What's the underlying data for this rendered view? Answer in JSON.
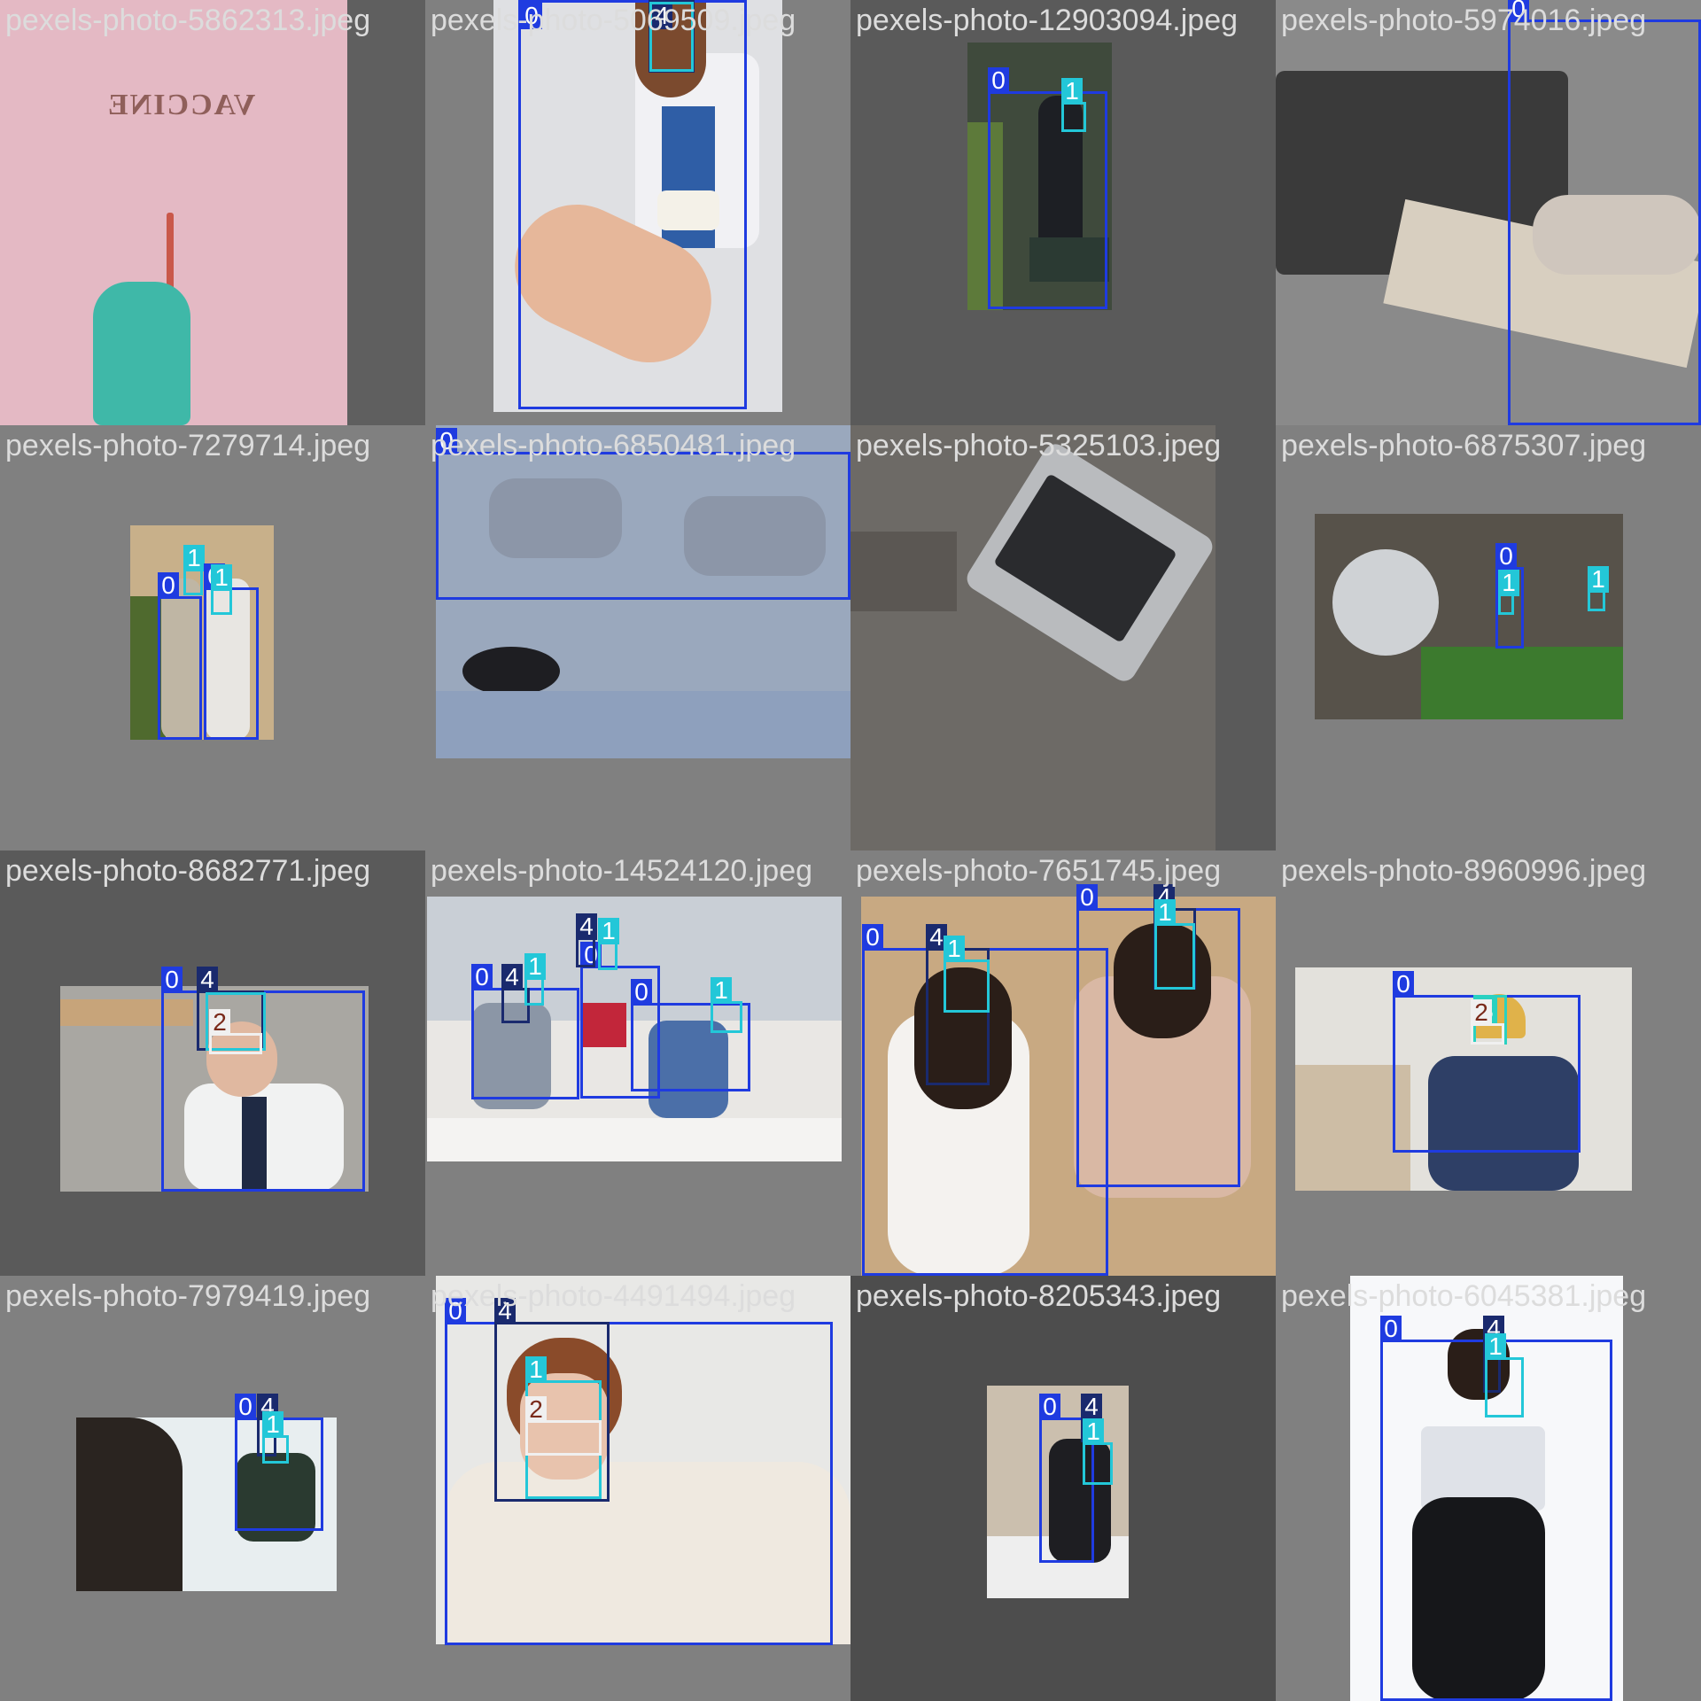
{
  "cells": [
    {
      "file": "pexels-photo-5862313.jpeg",
      "image_text": "VACCINE",
      "labels": []
    },
    {
      "file": "pexels-photo-5069509.jpeg",
      "labels": [
        "0",
        "4"
      ]
    },
    {
      "file": "pexels-photo-12903094.jpeg",
      "labels": [
        "0",
        "1"
      ]
    },
    {
      "file": "pexels-photo-5974016.jpeg",
      "labels": [
        "0"
      ]
    },
    {
      "file": "pexels-photo-7279714.jpeg",
      "labels": [
        "0",
        "1",
        "0",
        "1"
      ]
    },
    {
      "file": "pexels-photo-6850481.jpeg",
      "labels": [
        "0"
      ]
    },
    {
      "file": "pexels-photo-5325103.jpeg",
      "labels": []
    },
    {
      "file": "pexels-photo-6875307.jpeg",
      "labels": [
        "0",
        "1",
        "1"
      ]
    },
    {
      "file": "pexels-photo-8682771.jpeg",
      "labels": [
        "0",
        "4",
        "2"
      ]
    },
    {
      "file": "pexels-photo-14524120.jpeg",
      "labels": [
        "0",
        "4",
        "1",
        "0",
        "4",
        "1",
        "0",
        "1"
      ]
    },
    {
      "file": "pexels-photo-7651745.jpeg",
      "labels": [
        "0",
        "4",
        "1",
        "0",
        "4",
        "1"
      ]
    },
    {
      "file": "pexels-photo-8960996.jpeg",
      "labels": [
        "0",
        "3",
        "2"
      ]
    },
    {
      "file": "pexels-photo-7979419.jpeg",
      "labels": [
        "0",
        "4",
        "1"
      ]
    },
    {
      "file": "pexels-photo-4491494.jpeg",
      "labels": [
        "0",
        "4",
        "1",
        "2"
      ]
    },
    {
      "file": "pexels-photo-8205343.jpeg",
      "labels": [
        "0",
        "4",
        "1"
      ]
    },
    {
      "file": "pexels-photo-6045381.jpeg",
      "labels": [
        "0",
        "4",
        "1"
      ]
    }
  ],
  "colors": {
    "background": "#808080",
    "class_0": "#1f3be0",
    "class_1": "#23c7d8",
    "class_2": "#f0f0f0",
    "class_3": "#2ad1c1",
    "class_4": "#1a2a6e",
    "filename_text": "#dcdcdc"
  }
}
